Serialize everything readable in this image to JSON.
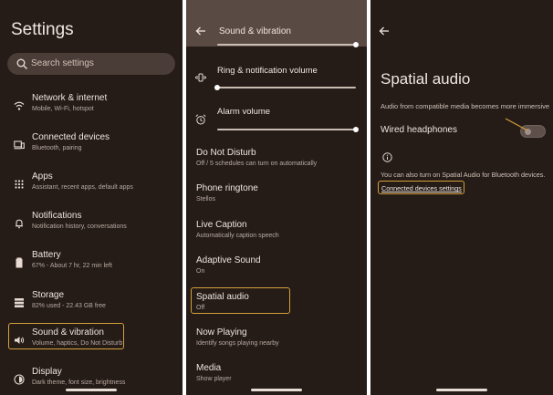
{
  "settings": {
    "title": "Settings",
    "search_placeholder": "Search settings",
    "items": [
      {
        "title": "Network & internet",
        "subtitle": "Mobile, Wi-Fi, hotspot"
      },
      {
        "title": "Connected devices",
        "subtitle": "Bluetooth, pairing"
      },
      {
        "title": "Apps",
        "subtitle": "Assistant, recent apps, default apps"
      },
      {
        "title": "Notifications",
        "subtitle": "Notification history, conversations"
      },
      {
        "title": "Battery",
        "subtitle": "67% - About 7 hr, 22 min left"
      },
      {
        "title": "Storage",
        "subtitle": "82% used - 22.43 GB free"
      },
      {
        "title": "Sound & vibration",
        "subtitle": "Volume, haptics, Do Not Disturb"
      },
      {
        "title": "Display",
        "subtitle": "Dark theme, font size, brightness"
      }
    ]
  },
  "sound": {
    "title": "Sound & vibration",
    "volumes": [
      {
        "label": "",
        "level": 1.0
      },
      {
        "label": "Ring & notification volume",
        "level": 0.0
      },
      {
        "label": "Alarm volume",
        "level": 1.0
      }
    ],
    "items": [
      {
        "title": "Do Not Disturb",
        "subtitle": "Off / 5 schedules can turn on automatically"
      },
      {
        "title": "Phone ringtone",
        "subtitle": "Stellos"
      },
      {
        "title": "Live Caption",
        "subtitle": "Automatically caption speech"
      },
      {
        "title": "Adaptive Sound",
        "subtitle": "On"
      },
      {
        "title": "Spatial audio",
        "subtitle": "Off"
      },
      {
        "title": "Now Playing",
        "subtitle": "Identify songs playing nearby"
      },
      {
        "title": "Media",
        "subtitle": "Show player"
      }
    ]
  },
  "spatial": {
    "title": "Spatial audio",
    "description": "Audio from compatible media becomes more immersive",
    "wired_label": "Wired headphones",
    "wired_on": false,
    "bluetooth_note": "You can also turn on Spatial Audio for Bluetooth devices.",
    "link": "Connected devices settings"
  },
  "colors": {
    "background": "#251b17",
    "highlight": "#d4a13b"
  }
}
